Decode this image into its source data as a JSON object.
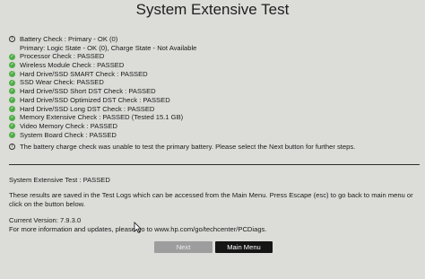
{
  "header": {
    "title": "System Extensive Test"
  },
  "checks": {
    "battery": "Battery Check : Primary - OK (0)",
    "battery_detail": "Primary: Logic State - OK (0), Charge State - Not Available",
    "items": [
      "Processor Check : PASSED",
      "Wireless Module Check : PASSED",
      "Hard Drive/SSD SMART Check : PASSED",
      "SSD Wear Check: PASSED",
      "Hard Drive/SSD Short DST Check : PASSED",
      "Hard Drive/SSD Optimized DST Check : PASSED",
      "Hard Drive/SSD Long DST Check : PASSED",
      "Memory Extensive Check : PASSED (Tested 15.1 GB)",
      "Video Memory Check : PASSED",
      "System Board Check : PASSED"
    ]
  },
  "message": "The battery charge check was unable to test the primary battery. Please select the Next button for further steps.",
  "summary": "System Extensive Test : PASSED",
  "saved_note": "These results are saved in the Test Logs which can be accessed from the Main Menu. Press Escape (esc) to go back to main menu or click on the button below.",
  "version": "Current Version: 7.9.3.0",
  "info": "For more information and updates, please go to www.hp.com/go/techcenter/PCDiags.",
  "buttons": {
    "next": "Next",
    "main_menu": "Main Menu"
  },
  "icons": {
    "pass": "check-circle-icon",
    "info": "info-circle-icon"
  },
  "colors": {
    "pass": "#4fae46",
    "primary_button": "#151515",
    "disabled_button": "#9d9d9d"
  }
}
